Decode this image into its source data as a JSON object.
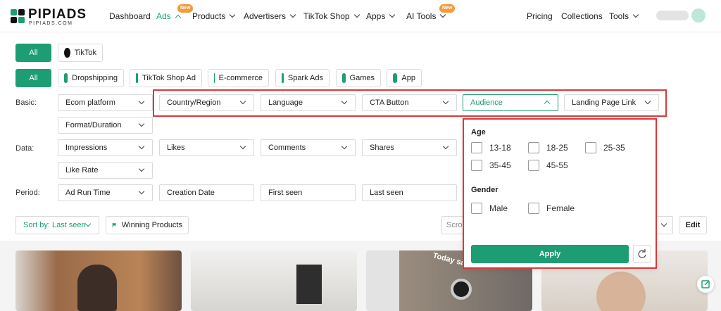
{
  "brand": {
    "name": "PIPIADS",
    "tagline": "PIPIADS.COM"
  },
  "nav": {
    "items": [
      {
        "label": "Dashboard"
      },
      {
        "label": "Ads",
        "badge": "New"
      },
      {
        "label": "Products"
      },
      {
        "label": "Advertisers"
      },
      {
        "label": "TikTok Shop"
      },
      {
        "label": "Apps"
      },
      {
        "label": "AI Tools",
        "badge": "New"
      }
    ],
    "right": [
      {
        "label": "Pricing"
      },
      {
        "label": "Collections"
      },
      {
        "label": "Tools"
      }
    ]
  },
  "platform_filter": {
    "all": "All",
    "tiktok": "TikTok"
  },
  "category_filter": [
    "All",
    "Dropshipping",
    "TikTok Shop Ad",
    "E-commerce",
    "Spark Ads",
    "Games",
    "App"
  ],
  "filters": {
    "basic_label": "Basic:",
    "basic": [
      "Ecom platform",
      "Country/Region",
      "Language",
      "CTA Button",
      "Audience",
      "Landing Page Link",
      "Format/Duration"
    ],
    "data_label": "Data:",
    "data": [
      "Impressions",
      "Likes",
      "Comments",
      "Shares",
      "Like Rate"
    ],
    "period_label": "Period:",
    "period": [
      "Ad Run Time",
      "Creation Date",
      "First seen",
      "Last seen"
    ]
  },
  "audience_dropdown": {
    "age_title": "Age",
    "ages": [
      "13-18",
      "18-25",
      "25-35",
      "35-45",
      "45-55"
    ],
    "gender_title": "Gender",
    "genders": [
      "Male",
      "Female"
    ],
    "apply_label": "Apply"
  },
  "toolbar": {
    "sort_label": "Sort by: Last seen",
    "winning_label": "Winning Products",
    "search_placeholder": "Scro",
    "edit_label": "Edit"
  },
  "colors": {
    "accent": "#1d9d74",
    "highlight": "#d83a3a",
    "badge": "#f39a3a"
  },
  "cards": [
    {
      "overlay": ""
    },
    {
      "overlay": ""
    },
    {
      "overlay": "Today sale"
    },
    {
      "overlay": ""
    }
  ]
}
